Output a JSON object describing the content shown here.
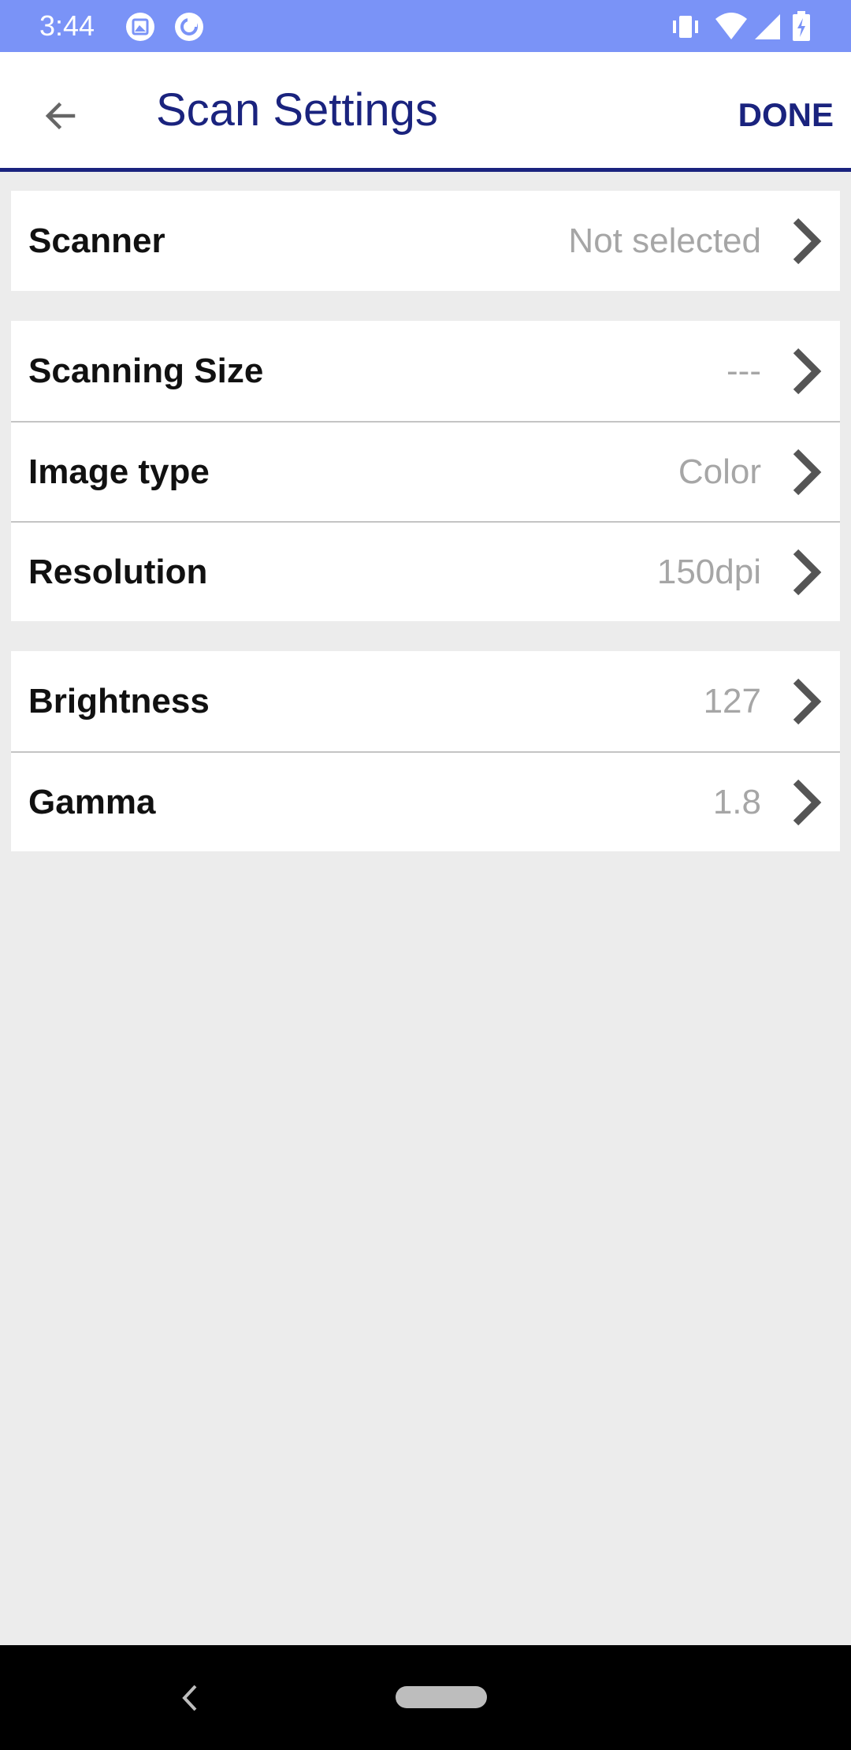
{
  "status_bar": {
    "time": "3:44",
    "icons": [
      "photo-icon",
      "at-sign-icon",
      "vibrate-icon",
      "wifi-icon",
      "signal-icon",
      "battery-charging-icon"
    ]
  },
  "app_bar": {
    "title": "Scan Settings",
    "done_label": "DONE",
    "accent_color": "#1a237e"
  },
  "groups": [
    {
      "rows": [
        {
          "label": "Scanner",
          "value": "Not selected"
        }
      ]
    },
    {
      "rows": [
        {
          "label": "Scanning Size",
          "value": "---"
        },
        {
          "label": "Image type",
          "value": "Color"
        },
        {
          "label": "Resolution",
          "value": "150dpi"
        }
      ]
    },
    {
      "rows": [
        {
          "label": "Brightness",
          "value": "127"
        },
        {
          "label": "Gamma",
          "value": "1.8"
        }
      ]
    }
  ],
  "colors": {
    "status_bar": "#7a93f7",
    "background": "#ececec",
    "value_text": "#a6a6a6"
  }
}
